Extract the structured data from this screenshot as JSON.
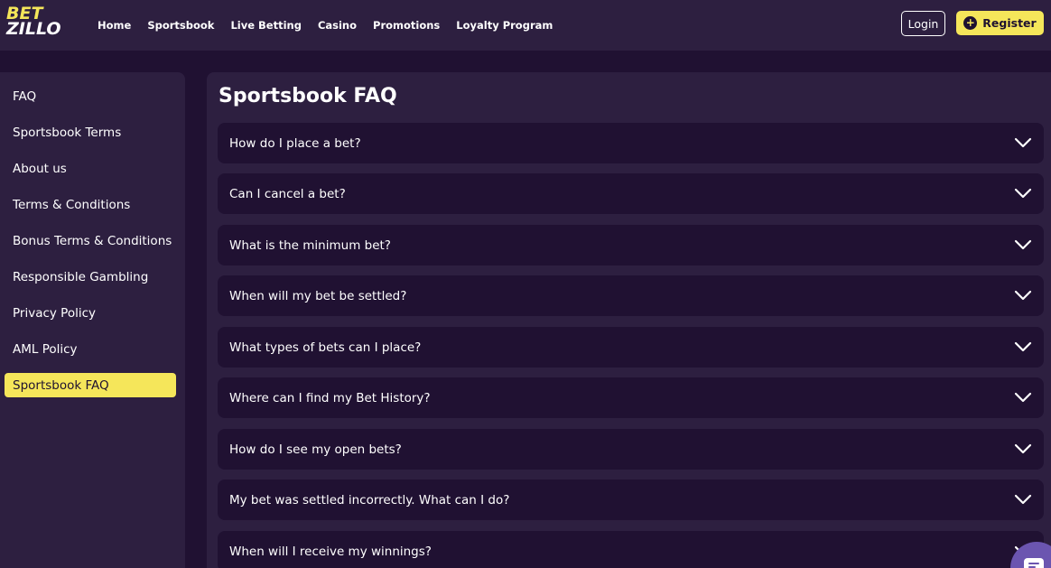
{
  "brand": {
    "line1": "BET",
    "line2": "ZILLO"
  },
  "nav": {
    "items": [
      {
        "label": "Home"
      },
      {
        "label": "Sportsbook"
      },
      {
        "label": "Live Betting"
      },
      {
        "label": "Casino"
      },
      {
        "label": "Promotions"
      },
      {
        "label": "Loyalty Program"
      }
    ],
    "login_label": "Login",
    "register_label": "Register"
  },
  "sidebar": {
    "items": [
      {
        "label": "FAQ"
      },
      {
        "label": "Sportsbook Terms"
      },
      {
        "label": "About us"
      },
      {
        "label": "Terms & Conditions"
      },
      {
        "label": "Bonus Terms & Conditions"
      },
      {
        "label": "Responsible Gambling"
      },
      {
        "label": "Privacy Policy"
      },
      {
        "label": "AML Policy"
      },
      {
        "label": "Sportsbook FAQ",
        "active": true
      }
    ]
  },
  "main": {
    "title": "Sportsbook FAQ",
    "questions": [
      {
        "q": "How do I place a bet?"
      },
      {
        "q": "Can I cancel a bet?"
      },
      {
        "q": "What is the minimum bet?"
      },
      {
        "q": "When will my bet be settled?"
      },
      {
        "q": "What types of bets can I place?"
      },
      {
        "q": "Where can I find my Bet History?"
      },
      {
        "q": "How do I see my open bets?"
      },
      {
        "q": "My bet was settled incorrectly. What can I do?"
      },
      {
        "q": "When will I receive my winnings?"
      }
    ]
  },
  "icons": {
    "register": "plus-circle-icon",
    "accordion": "chevron-down-icon",
    "chat": "chat-icon"
  },
  "colors": {
    "accent": "#f5e65a",
    "background": "#201132",
    "panel": "#2d1f40",
    "chat": "#6b55b0"
  }
}
